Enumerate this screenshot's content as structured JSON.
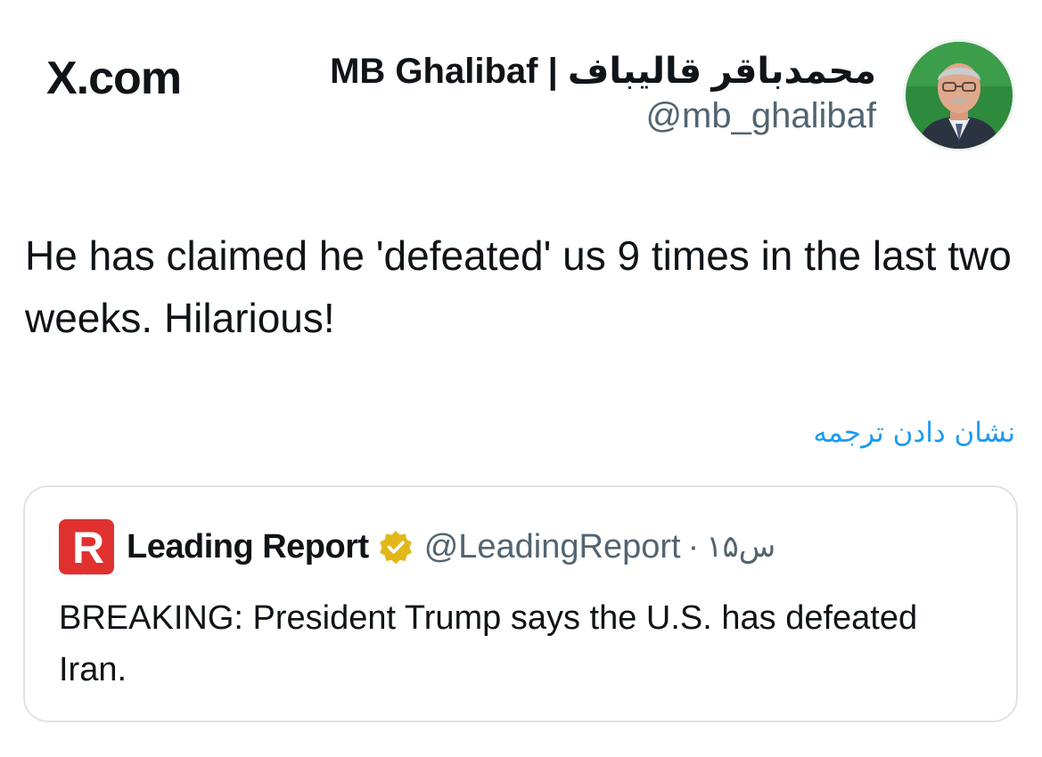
{
  "header": {
    "brand": "X.com",
    "author_name": "MB Ghalibaf | محمدباقر قالیباف",
    "author_handle": "@mb_ghalibaf",
    "avatar_icon": "profile-photo"
  },
  "tweet": {
    "text": "He has claimed he 'defeated' us 9 times in the last two weeks. Hilarious!",
    "translate_label": "نشان دادن ترجمه"
  },
  "quote": {
    "logo_icon": "leading-report-logo",
    "logo_letter": "R",
    "name": "Leading Report",
    "badge_icon": "verified-badge-icon",
    "handle": "@LeadingReport",
    "separator": "·",
    "time": "۱۵س",
    "text": "BREAKING: President Trump says the U.S. has defeated Iran."
  },
  "colors": {
    "text": "#0f1419",
    "secondary": "#536471",
    "link": "#1d9bf0",
    "badge": "#e2b719",
    "logo": "#e0312f",
    "border": "#dfe3e6"
  }
}
